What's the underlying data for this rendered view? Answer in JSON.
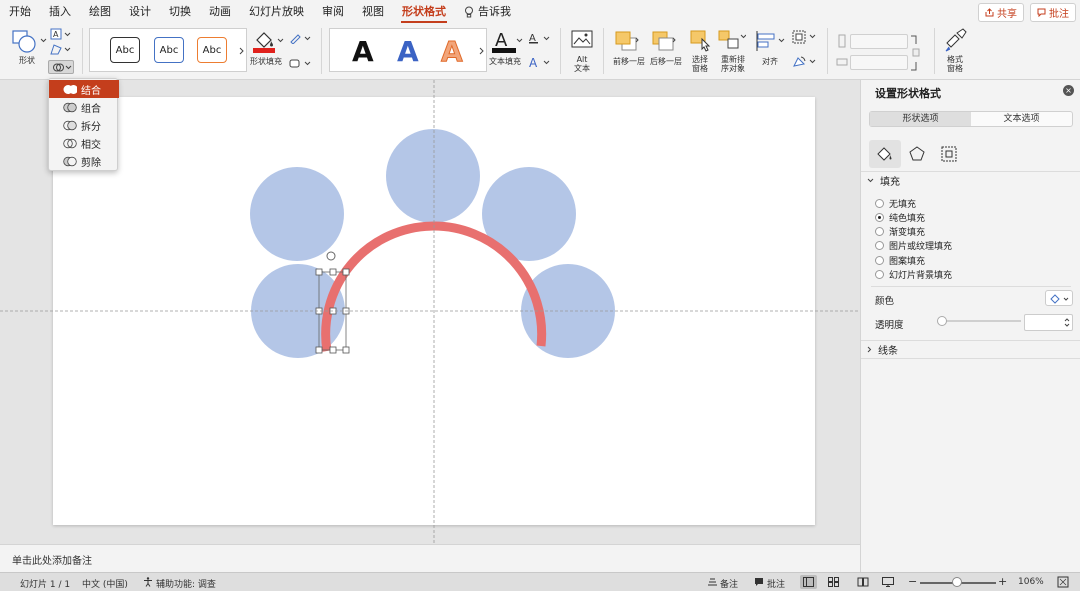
{
  "tabs": [
    "开始",
    "插入",
    "绘图",
    "设计",
    "切换",
    "动画",
    "幻灯片放映",
    "审阅",
    "视图",
    "形状格式"
  ],
  "active_tab": "形状格式",
  "tell_me": "告诉我",
  "share_button": "共享",
  "comments_button": "批注",
  "ribbon": {
    "shape_label": "形状",
    "shape_styles": [
      "Abc",
      "Abc",
      "Abc"
    ],
    "shape_fill_label": "形状填充",
    "wordart_letters": [
      "A",
      "A",
      "A"
    ],
    "text_fill_label": "文本填充",
    "alt_text_label": "Alt\n文本",
    "bring_forward_label": "前移一层",
    "send_backward_label": "后移一层",
    "selection_pane_label": "选择\n窗格",
    "reorder_label": "重新排\n序对象",
    "align_label": "对齐",
    "format_pane_label": "格式\n窗格",
    "colors": {
      "accent": "#c43e1c",
      "fill_red": "#e0211c",
      "wordart_blue": "#3b63c4",
      "wordart_orange": "#f2a57a"
    }
  },
  "merge_menu": {
    "items": [
      {
        "label": "结合",
        "icon": "union-icon",
        "selected": true
      },
      {
        "label": "组合",
        "icon": "combine-icon",
        "selected": false
      },
      {
        "label": "拆分",
        "icon": "fragment-icon",
        "selected": false
      },
      {
        "label": "相交",
        "icon": "intersect-icon",
        "selected": false
      },
      {
        "label": "剪除",
        "icon": "subtract-icon",
        "selected": false
      }
    ]
  },
  "slide": {
    "circle_color": "#b4c6e7",
    "arc_color": "#e8706f"
  },
  "notes_placeholder": "单击此处添加备注",
  "format_pane": {
    "title": "设置形状格式",
    "tabs": [
      "形状选项",
      "文本选项"
    ],
    "fill_section": "填充",
    "fill_options": [
      {
        "label": "无填充",
        "checked": false
      },
      {
        "label": "纯色填充",
        "checked": true
      },
      {
        "label": "渐变填充",
        "checked": false
      },
      {
        "label": "图片或纹理填充",
        "checked": false
      },
      {
        "label": "图案填充",
        "checked": false
      },
      {
        "label": "幻灯片背景填充",
        "checked": false
      }
    ],
    "color_label": "颜色",
    "transparency_label": "透明度",
    "line_section": "线条"
  },
  "status": {
    "slide_counter": "幻灯片 1 / 1",
    "language": "中文 (中国)",
    "accessibility": "辅助功能: 调查",
    "notes_btn": "备注",
    "comments_btn": "批注",
    "zoom": "106%"
  }
}
